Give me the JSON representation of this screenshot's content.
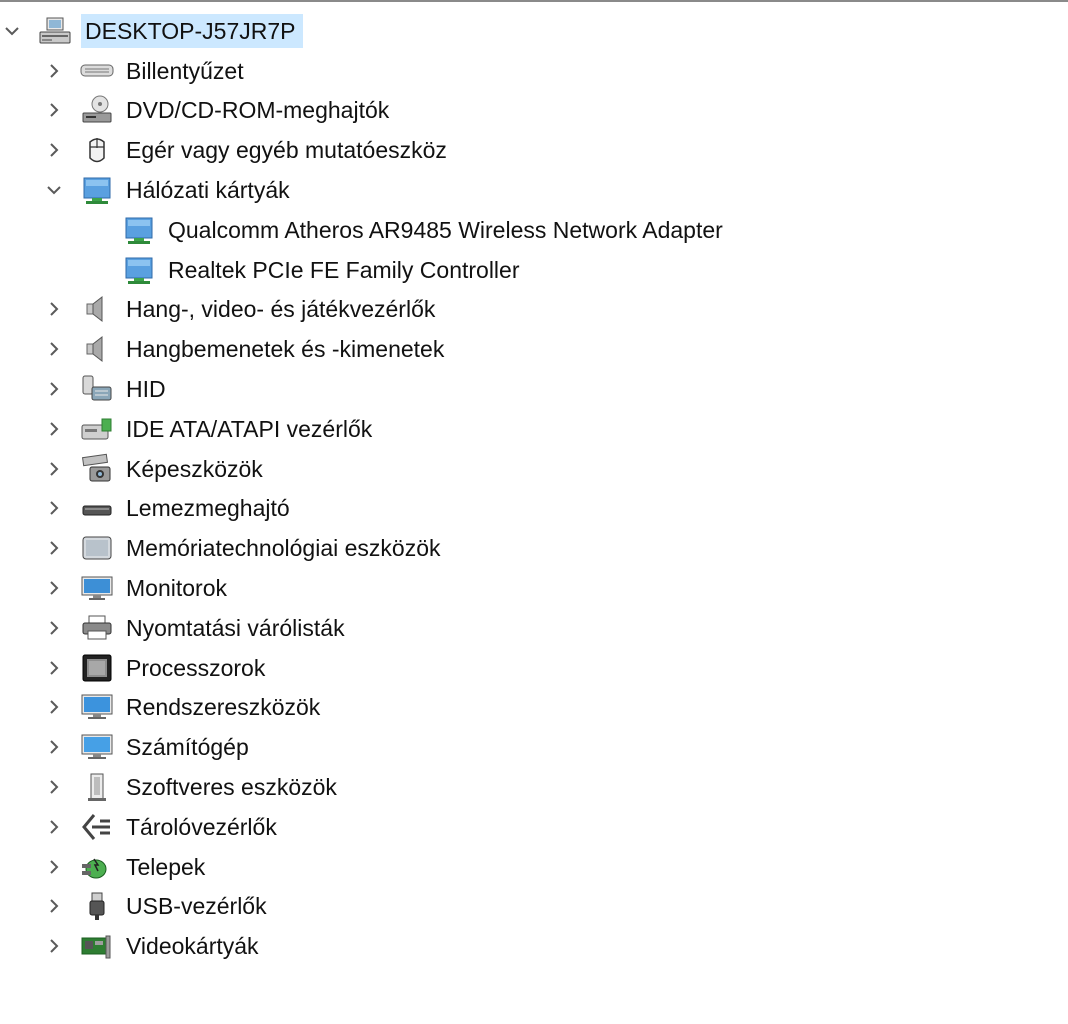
{
  "tree": {
    "root": {
      "label": "DESKTOP-J57JR7P",
      "icon": "computer-icon",
      "expanded": true
    },
    "categories": [
      {
        "label": "Billentyűzet",
        "icon": "keyboard-icon",
        "expanded": false
      },
      {
        "label": "DVD/CD-ROM-meghajtók",
        "icon": "dvd-drive-icon",
        "expanded": false
      },
      {
        "label": "Egér vagy egyéb mutatóeszköz",
        "icon": "mouse-icon",
        "expanded": false
      },
      {
        "label": "Hálózati kártyák",
        "icon": "network-adapter-icon",
        "expanded": true,
        "children": [
          {
            "label": "Qualcomm Atheros AR9485 Wireless Network Adapter",
            "icon": "network-adapter-icon"
          },
          {
            "label": "Realtek PCIe FE Family Controller",
            "icon": "network-adapter-icon"
          }
        ]
      },
      {
        "label": "Hang-, video- és játékvezérlők",
        "icon": "speaker-icon",
        "expanded": false
      },
      {
        "label": "Hangbemenetek és -kimenetek",
        "icon": "speaker-icon",
        "expanded": false
      },
      {
        "label": "HID",
        "icon": "hid-icon",
        "expanded": false
      },
      {
        "label": "IDE ATA/ATAPI vezérlők",
        "icon": "ide-controller-icon",
        "expanded": false
      },
      {
        "label": "Képeszközök",
        "icon": "camera-icon",
        "expanded": false
      },
      {
        "label": "Lemezmeghajtó",
        "icon": "disk-drive-icon",
        "expanded": false
      },
      {
        "label": "Memóriatechnológiai eszközök",
        "icon": "memory-device-icon",
        "expanded": false
      },
      {
        "label": "Monitorok",
        "icon": "monitor-icon",
        "expanded": false
      },
      {
        "label": "Nyomtatási várólisták",
        "icon": "printer-icon",
        "expanded": false
      },
      {
        "label": "Processzorok",
        "icon": "processor-icon",
        "expanded": false
      },
      {
        "label": "Rendszereszközök",
        "icon": "system-device-icon",
        "expanded": false
      },
      {
        "label": "Számítógép",
        "icon": "computer-monitor-icon",
        "expanded": false
      },
      {
        "label": "Szoftveres eszközök",
        "icon": "software-device-icon",
        "expanded": false
      },
      {
        "label": "Tárolóvezérlők",
        "icon": "storage-controller-icon",
        "expanded": false
      },
      {
        "label": "Telepek",
        "icon": "battery-icon",
        "expanded": false
      },
      {
        "label": "USB-vezérlők",
        "icon": "usb-icon",
        "expanded": false
      },
      {
        "label": "Videokártyák",
        "icon": "display-adapter-icon",
        "expanded": false
      }
    ]
  },
  "colors": {
    "selection": "#cce8ff",
    "chevron": "#5a5a5a",
    "text": "#111111"
  }
}
